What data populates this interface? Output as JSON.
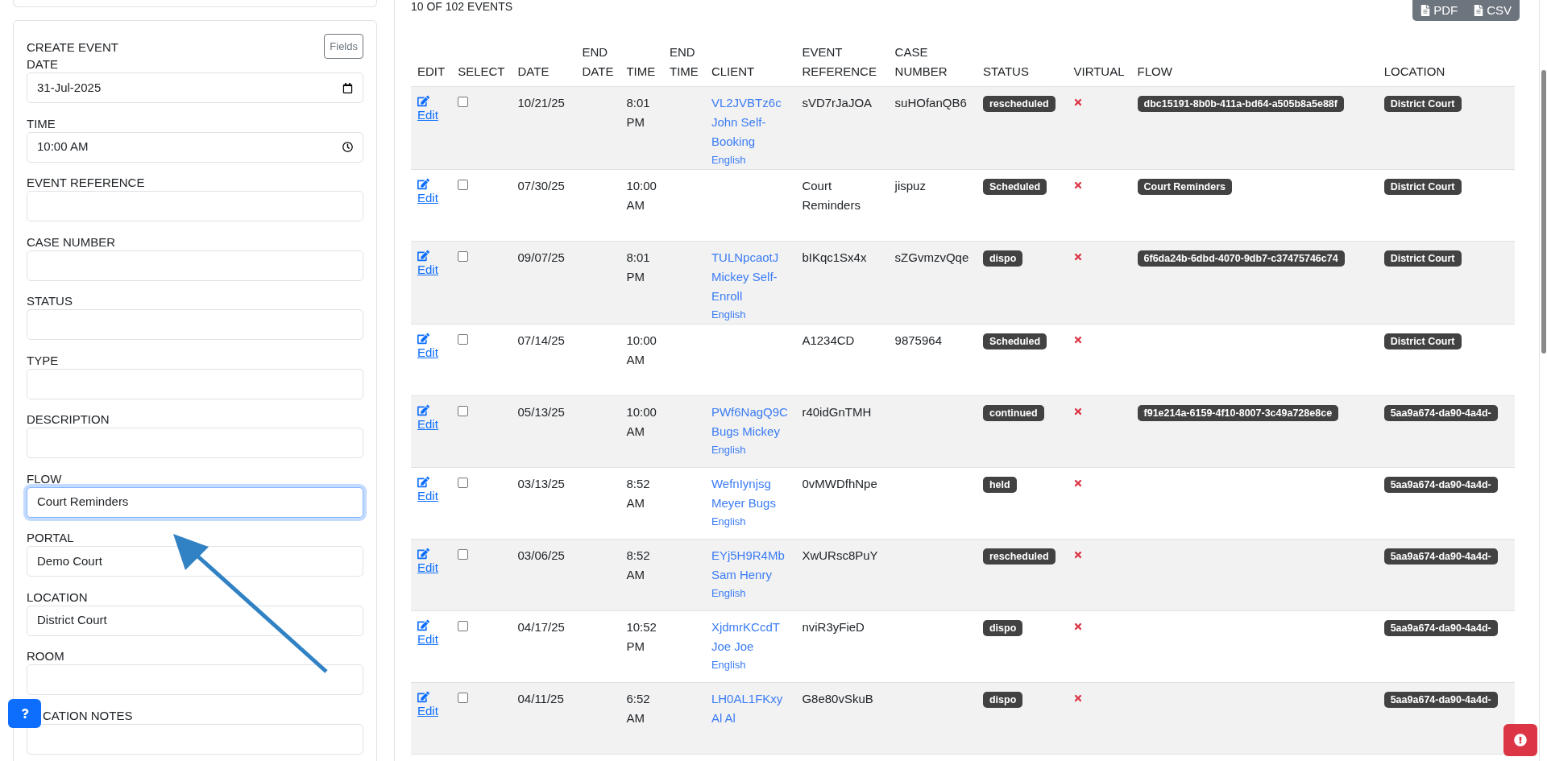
{
  "form": {
    "title": "CREATE EVENT",
    "fields_button": "Fields",
    "fields": [
      {
        "label": "DATE",
        "kind": "date",
        "value": "31-Jul-2025",
        "focused": false
      },
      {
        "label": "TIME",
        "kind": "time",
        "value": "10:00 AM",
        "focused": false
      },
      {
        "label": "EVENT REFERENCE",
        "kind": "text",
        "focused": false
      },
      {
        "label": "CASE NUMBER",
        "kind": "text",
        "focused": false
      },
      {
        "label": "STATUS",
        "kind": "text",
        "focused": false
      },
      {
        "label": "TYPE",
        "kind": "text",
        "focused": false
      },
      {
        "label": "DESCRIPTION",
        "kind": "text",
        "focused": false
      },
      {
        "label": "FLOW",
        "kind": "text",
        "value": "Court Reminders",
        "focused": true
      },
      {
        "label": "PORTAL",
        "kind": "text",
        "value": "Demo Court",
        "focused": false
      },
      {
        "label": "LOCATION",
        "kind": "text",
        "value": "District Court",
        "focused": false
      },
      {
        "label": "ROOM",
        "kind": "text",
        "focused": false
      },
      {
        "label": "CATION NOTES",
        "kind": "text",
        "focused": false
      }
    ]
  },
  "events": {
    "count": "10 OF 102 EVENTS",
    "exports": [
      {
        "label": "PDF"
      },
      {
        "label": "CSV"
      }
    ],
    "columns": [
      [
        "EDIT"
      ],
      [
        "SELECT"
      ],
      [
        "DATE"
      ],
      [
        "END",
        "DATE"
      ],
      [
        "TIME"
      ],
      [
        "END",
        "TIME"
      ],
      [
        "CLIENT"
      ],
      [
        "EVENT",
        "REFERENCE"
      ],
      [
        "CASE",
        "NUMBER"
      ],
      [
        "STATUS"
      ],
      [
        "VIRTUAL"
      ],
      [
        "FLOW"
      ],
      [
        "LOCATION"
      ]
    ],
    "rows": [
      {
        "edit": "Edit",
        "selected": false,
        "date": "10/21/25",
        "time": [
          "8:01",
          "PM"
        ],
        "client": [
          "VL2JVBTz6c",
          "John Self-",
          "Booking"
        ],
        "language": "English",
        "event_reference": [
          "sVD7rJaJOA"
        ],
        "case_number": "suHOfanQB6",
        "status": "rescheduled",
        "virtual": false,
        "flow": "dbc15191-8b0b-411a-bd64-a505b8a5e88f",
        "location": "District Court"
      },
      {
        "edit": "Edit",
        "selected": false,
        "date": "07/30/25",
        "time": [
          "10:00",
          "AM"
        ],
        "event_reference": [
          "Court",
          "Reminders"
        ],
        "case_number": "jispuz",
        "status": "Scheduled",
        "virtual": false,
        "flow": "Court Reminders",
        "location": "District Court"
      },
      {
        "edit": "Edit",
        "selected": false,
        "date": "09/07/25",
        "time": [
          "8:01",
          "PM"
        ],
        "client": [
          "TULNpcaotJ",
          "Mickey Self-",
          "Enroll"
        ],
        "language": "English",
        "event_reference": [
          "bIKqc1Sx4x"
        ],
        "case_number": "sZGvmzvQqe",
        "status": "dispo",
        "virtual": false,
        "flow": "6f6da24b-6dbd-4070-9db7-c37475746c74",
        "location": "District Court"
      },
      {
        "edit": "Edit",
        "selected": false,
        "date": "07/14/25",
        "time": [
          "10:00",
          "AM"
        ],
        "event_reference": [
          "A1234CD"
        ],
        "case_number": "9875964",
        "status": "Scheduled",
        "virtual": false,
        "location": "District Court"
      },
      {
        "edit": "Edit",
        "selected": false,
        "date": "05/13/25",
        "time": [
          "10:00",
          "AM"
        ],
        "client": [
          "PWf6NagQ9C",
          "Bugs Mickey"
        ],
        "language": "English",
        "event_reference": [
          "r40idGnTMH"
        ],
        "status": "continued",
        "virtual": false,
        "flow": "f91e214a-6159-4f10-8007-3c49a728e8ce",
        "location": "5aa9a674-da90-4a4d-"
      },
      {
        "edit": "Edit",
        "selected": false,
        "date": "03/13/25",
        "time": [
          "8:52",
          "AM"
        ],
        "client": [
          "WefnIynjsg",
          "Meyer Bugs"
        ],
        "language": "English",
        "event_reference": [
          "0vMWDfhNpe"
        ],
        "status": "held",
        "virtual": false,
        "location": "5aa9a674-da90-4a4d-"
      },
      {
        "edit": "Edit",
        "selected": false,
        "date": "03/06/25",
        "time": [
          "8:52",
          "AM"
        ],
        "client": [
          "EYj5H9R4Mb",
          "Sam Henry"
        ],
        "language": "English",
        "event_reference": [
          "XwURsc8PuY"
        ],
        "status": "rescheduled",
        "virtual": false,
        "location": "5aa9a674-da90-4a4d-"
      },
      {
        "edit": "Edit",
        "selected": false,
        "date": "04/17/25",
        "time": [
          "10:52",
          "PM"
        ],
        "client": [
          "XjdmrKCcdT",
          "Joe Joe"
        ],
        "language": "English",
        "event_reference": [
          "nviR3yFieD"
        ],
        "status": "dispo",
        "virtual": false,
        "location": "5aa9a674-da90-4a4d-"
      },
      {
        "edit": "Edit",
        "selected": false,
        "date": "04/11/25",
        "time": [
          "6:52",
          "AM"
        ],
        "client": [
          "LH0AL1FKxy",
          "Al Al"
        ],
        "event_reference": [
          "G8e80vSkuB"
        ],
        "status": "dispo",
        "virtual": false,
        "location": "5aa9a674-da90-4a4d-"
      }
    ]
  }
}
